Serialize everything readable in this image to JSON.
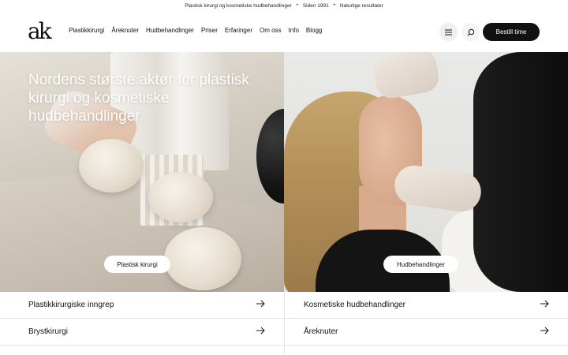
{
  "topbar": {
    "item1": "Plastisk kirurgi og kosmetiske hudbehandlinger",
    "item2": "Siden 1991",
    "item3": "Naturlige resultater",
    "separator": "•"
  },
  "header": {
    "logo": "ak",
    "nav": [
      "Plastikkirurgi",
      "Åreknuter",
      "Hudbehandlinger",
      "Priser",
      "Erfaringer",
      "Om oss",
      "Info",
      "Blogg"
    ],
    "cta": "Bestill time"
  },
  "hero": {
    "headline": "Nordens største aktør for plastisk kirurgi og kosmetiske hudbehandlinger",
    "left_button": "Plastisk kirurgi",
    "right_button": "Hudbehandlinger"
  },
  "lists": {
    "left": [
      "Plastikkirurgiske inngrep",
      "Brystkirurgi"
    ],
    "right": [
      "Kosmetiske hudbehandlinger",
      "Åreknuter"
    ]
  },
  "icons": {
    "menu": "hamburger-icon",
    "search": "search-icon",
    "arrow": "arrow-right-icon"
  },
  "colors": {
    "cta_bg": "#111111",
    "text": "#1a1a1a",
    "divider": "#e3e3e3"
  }
}
